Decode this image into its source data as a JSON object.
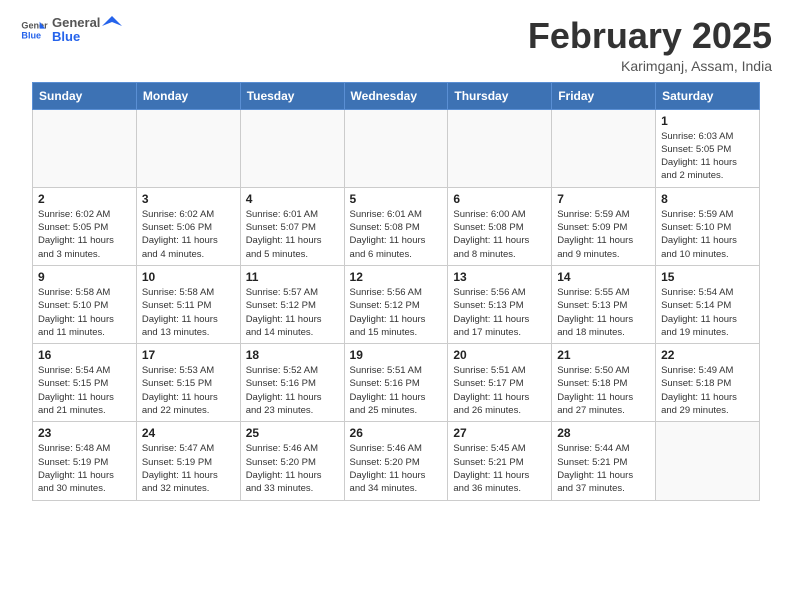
{
  "header": {
    "logo_general": "General",
    "logo_blue": "Blue",
    "month_title": "February 2025",
    "location": "Karimganj, Assam, India"
  },
  "weekdays": [
    "Sunday",
    "Monday",
    "Tuesday",
    "Wednesday",
    "Thursday",
    "Friday",
    "Saturday"
  ],
  "weeks": [
    [
      {
        "day": "",
        "info": ""
      },
      {
        "day": "",
        "info": ""
      },
      {
        "day": "",
        "info": ""
      },
      {
        "day": "",
        "info": ""
      },
      {
        "day": "",
        "info": ""
      },
      {
        "day": "",
        "info": ""
      },
      {
        "day": "1",
        "info": "Sunrise: 6:03 AM\nSunset: 5:05 PM\nDaylight: 11 hours and 2 minutes."
      }
    ],
    [
      {
        "day": "2",
        "info": "Sunrise: 6:02 AM\nSunset: 5:05 PM\nDaylight: 11 hours and 3 minutes."
      },
      {
        "day": "3",
        "info": "Sunrise: 6:02 AM\nSunset: 5:06 PM\nDaylight: 11 hours and 4 minutes."
      },
      {
        "day": "4",
        "info": "Sunrise: 6:01 AM\nSunset: 5:07 PM\nDaylight: 11 hours and 5 minutes."
      },
      {
        "day": "5",
        "info": "Sunrise: 6:01 AM\nSunset: 5:08 PM\nDaylight: 11 hours and 6 minutes."
      },
      {
        "day": "6",
        "info": "Sunrise: 6:00 AM\nSunset: 5:08 PM\nDaylight: 11 hours and 8 minutes."
      },
      {
        "day": "7",
        "info": "Sunrise: 5:59 AM\nSunset: 5:09 PM\nDaylight: 11 hours and 9 minutes."
      },
      {
        "day": "8",
        "info": "Sunrise: 5:59 AM\nSunset: 5:10 PM\nDaylight: 11 hours and 10 minutes."
      }
    ],
    [
      {
        "day": "9",
        "info": "Sunrise: 5:58 AM\nSunset: 5:10 PM\nDaylight: 11 hours and 11 minutes."
      },
      {
        "day": "10",
        "info": "Sunrise: 5:58 AM\nSunset: 5:11 PM\nDaylight: 11 hours and 13 minutes."
      },
      {
        "day": "11",
        "info": "Sunrise: 5:57 AM\nSunset: 5:12 PM\nDaylight: 11 hours and 14 minutes."
      },
      {
        "day": "12",
        "info": "Sunrise: 5:56 AM\nSunset: 5:12 PM\nDaylight: 11 hours and 15 minutes."
      },
      {
        "day": "13",
        "info": "Sunrise: 5:56 AM\nSunset: 5:13 PM\nDaylight: 11 hours and 17 minutes."
      },
      {
        "day": "14",
        "info": "Sunrise: 5:55 AM\nSunset: 5:13 PM\nDaylight: 11 hours and 18 minutes."
      },
      {
        "day": "15",
        "info": "Sunrise: 5:54 AM\nSunset: 5:14 PM\nDaylight: 11 hours and 19 minutes."
      }
    ],
    [
      {
        "day": "16",
        "info": "Sunrise: 5:54 AM\nSunset: 5:15 PM\nDaylight: 11 hours and 21 minutes."
      },
      {
        "day": "17",
        "info": "Sunrise: 5:53 AM\nSunset: 5:15 PM\nDaylight: 11 hours and 22 minutes."
      },
      {
        "day": "18",
        "info": "Sunrise: 5:52 AM\nSunset: 5:16 PM\nDaylight: 11 hours and 23 minutes."
      },
      {
        "day": "19",
        "info": "Sunrise: 5:51 AM\nSunset: 5:16 PM\nDaylight: 11 hours and 25 minutes."
      },
      {
        "day": "20",
        "info": "Sunrise: 5:51 AM\nSunset: 5:17 PM\nDaylight: 11 hours and 26 minutes."
      },
      {
        "day": "21",
        "info": "Sunrise: 5:50 AM\nSunset: 5:18 PM\nDaylight: 11 hours and 27 minutes."
      },
      {
        "day": "22",
        "info": "Sunrise: 5:49 AM\nSunset: 5:18 PM\nDaylight: 11 hours and 29 minutes."
      }
    ],
    [
      {
        "day": "23",
        "info": "Sunrise: 5:48 AM\nSunset: 5:19 PM\nDaylight: 11 hours and 30 minutes."
      },
      {
        "day": "24",
        "info": "Sunrise: 5:47 AM\nSunset: 5:19 PM\nDaylight: 11 hours and 32 minutes."
      },
      {
        "day": "25",
        "info": "Sunrise: 5:46 AM\nSunset: 5:20 PM\nDaylight: 11 hours and 33 minutes."
      },
      {
        "day": "26",
        "info": "Sunrise: 5:46 AM\nSunset: 5:20 PM\nDaylight: 11 hours and 34 minutes."
      },
      {
        "day": "27",
        "info": "Sunrise: 5:45 AM\nSunset: 5:21 PM\nDaylight: 11 hours and 36 minutes."
      },
      {
        "day": "28",
        "info": "Sunrise: 5:44 AM\nSunset: 5:21 PM\nDaylight: 11 hours and 37 minutes."
      },
      {
        "day": "",
        "info": ""
      }
    ]
  ]
}
